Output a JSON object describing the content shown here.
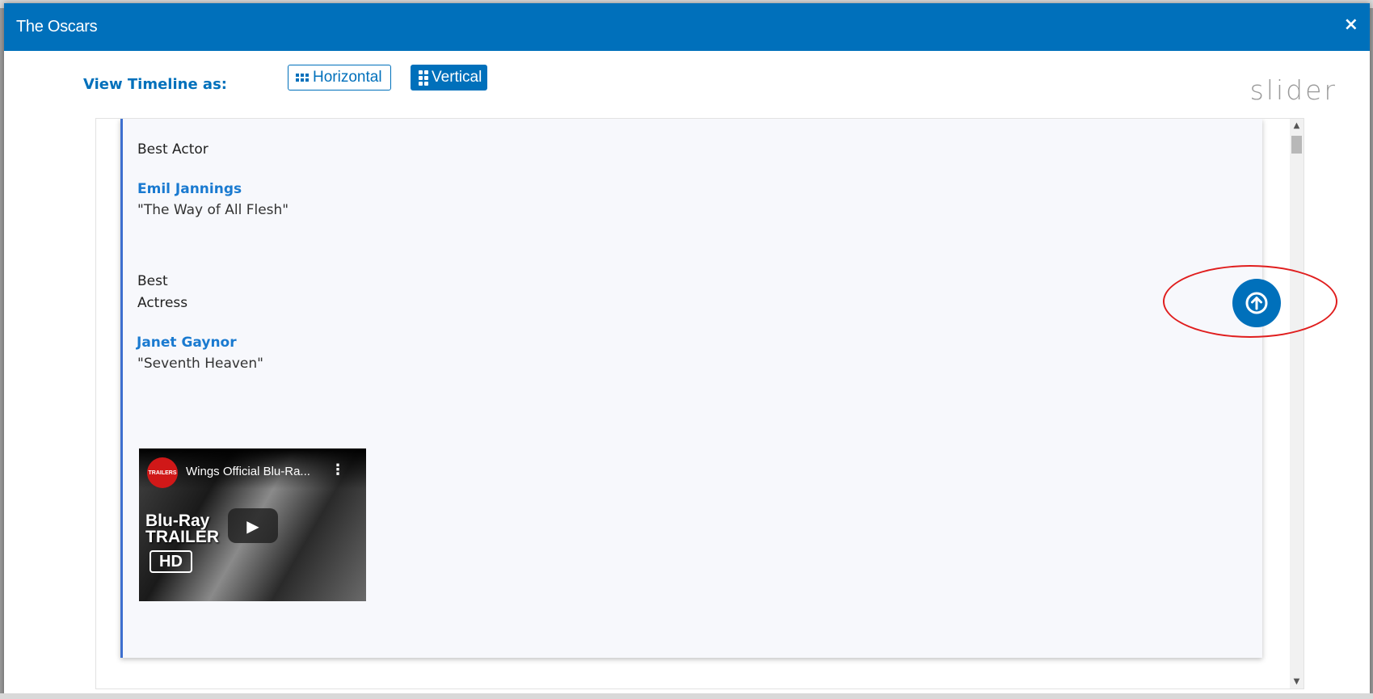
{
  "modal": {
    "title": "The Oscars",
    "close_label": "×"
  },
  "toolbar": {
    "view_label": "View Timeline as:",
    "horizontal_label": "Horizontal",
    "vertical_label": "Vertical",
    "slider_label": "slider"
  },
  "timeline": {
    "entries": [
      {
        "category": "Best Actor",
        "winner": "Emil Jannings",
        "film": "\"The Way of All Flesh\""
      },
      {
        "category_line1": "Best",
        "category_line2": "Actress",
        "winner": "Janet Gaynor",
        "film": "\"Seventh Heaven\""
      }
    ],
    "video": {
      "title": "Wings Official Blu-Ra...",
      "channel_logo": "TRAILERS",
      "overlay_line1": "Blu-Ray",
      "overlay_line2": "TRAILER",
      "badge": "HD"
    }
  },
  "colors": {
    "brand": "#0070bb",
    "highlight": "#e01e1e"
  },
  "icons": {
    "horizontal": "grid-icon",
    "vertical": "grid-icon",
    "scroll_up": "arrow-up-circle-icon",
    "close": "close-icon"
  }
}
